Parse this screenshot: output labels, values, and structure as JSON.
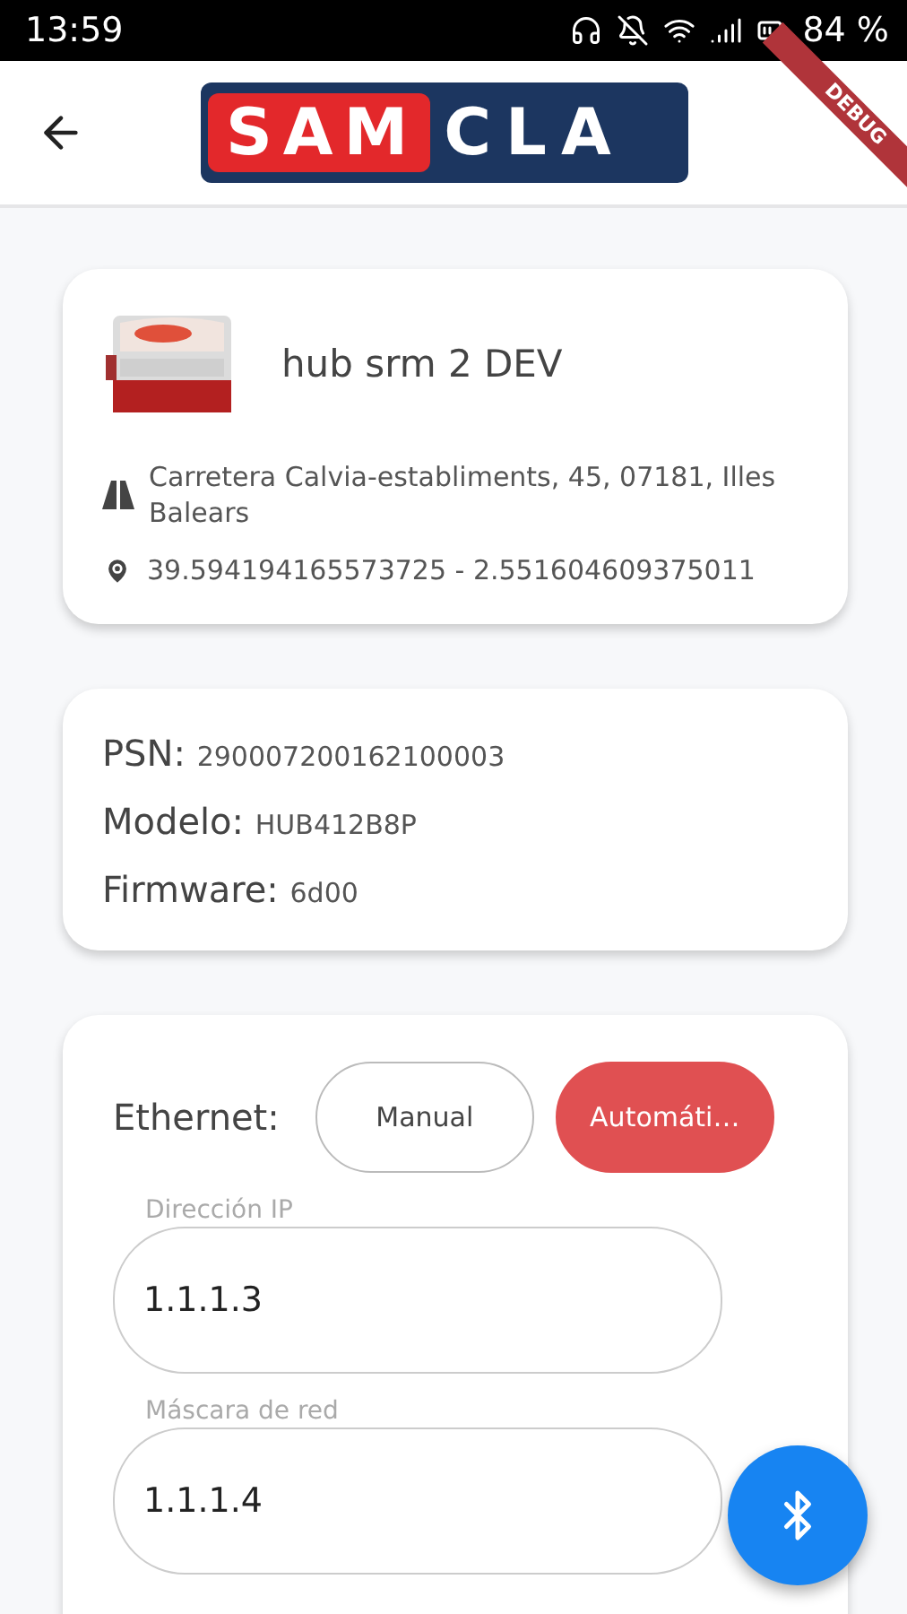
{
  "status_bar": {
    "time": "13:59",
    "battery": "84 %"
  },
  "debug_banner": "DEBUG",
  "app_bar": {
    "logo": [
      "SAM",
      "CLA"
    ]
  },
  "device": {
    "name": "hub srm 2 DEV",
    "address": "Carretera Calvia-establiments, 45, 07181, Illes Balears",
    "coordinates": "39.594194165573725 - 2.551604609375011"
  },
  "info": [
    {
      "label": "PSN:",
      "value": "290007200162100003"
    },
    {
      "label": "Modelo:",
      "value": "HUB412B8P"
    },
    {
      "label": "Firmware:",
      "value": "6d00"
    }
  ],
  "ethernet": {
    "label": "Ethernet:",
    "modes": [
      {
        "label": "Manual",
        "selected": false
      },
      {
        "label": "Automáti…",
        "selected": true
      }
    ],
    "fields": [
      {
        "label": "Dirección IP",
        "value": "1.1.1.3"
      },
      {
        "label": "Máscara de red",
        "value": "1.1.1.4"
      }
    ]
  }
}
